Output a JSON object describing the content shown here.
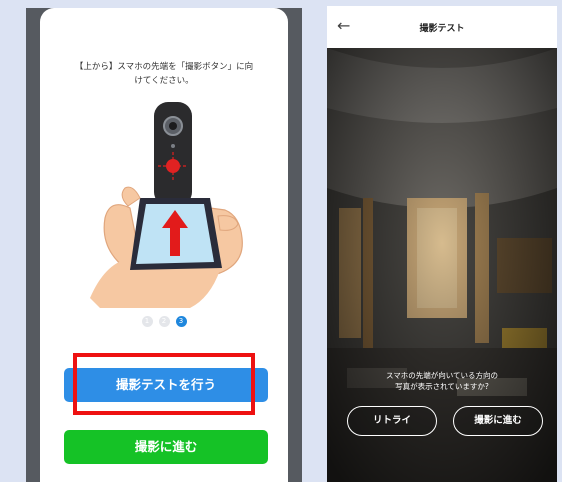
{
  "left_screen": {
    "instruction": "【上から】スマホの先端を「撮影ボタン」に向\nけてください。",
    "pager": [
      "1",
      "2",
      "3"
    ],
    "active_page": 3,
    "test_button_label": "撮影テストを行う",
    "proceed_button_label": "撮影に進む"
  },
  "right_screen": {
    "back_arrow": "←",
    "title": "撮影テスト",
    "question": "スマホの先端が向いている方向の\n写真が表示されていますか?",
    "retry_label": "リトライ",
    "proceed_label": "撮影に進む"
  },
  "colors": {
    "blue_button": "#2e8ee6",
    "green_button": "#15c226",
    "highlight": "#ee1111"
  }
}
